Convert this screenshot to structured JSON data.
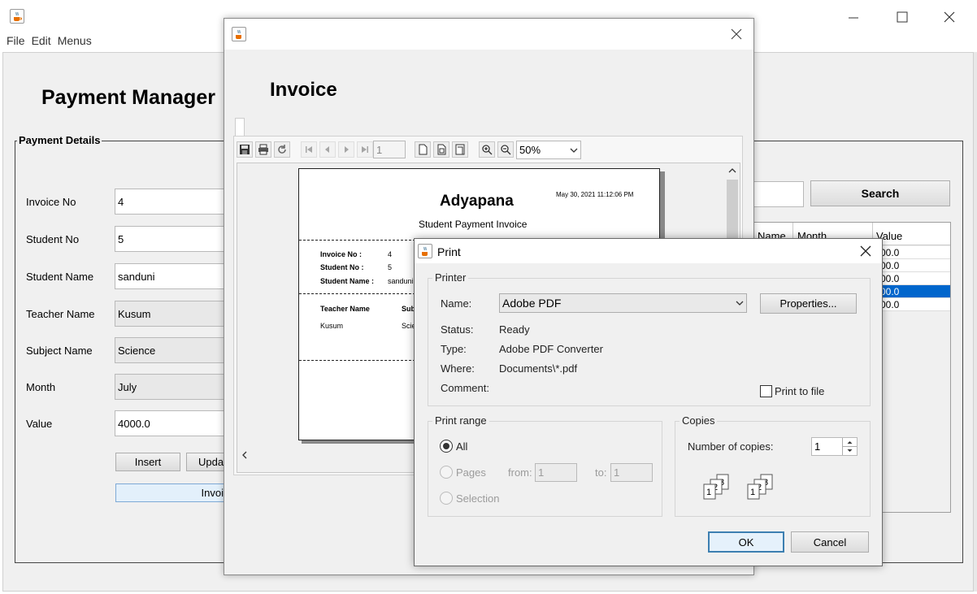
{
  "main_window": {
    "menus": [
      "File",
      "Edit",
      "Menus"
    ],
    "title": "Payment Manager",
    "group_title": "Payment Details",
    "fields": [
      {
        "label": "Invoice No",
        "value": "4",
        "readonly": false
      },
      {
        "label": "Student No",
        "value": "5",
        "readonly": false
      },
      {
        "label": "Student Name",
        "value": "sanduni",
        "readonly": false
      },
      {
        "label": "Teacher Name",
        "value": "Kusum",
        "readonly": true
      },
      {
        "label": "Subject Name",
        "value": "Science",
        "readonly": true
      },
      {
        "label": "Month",
        "value": "July",
        "readonly": true
      },
      {
        "label": "Value",
        "value": "4000.0",
        "readonly": false
      }
    ],
    "insert_label": "Insert",
    "update_label": "Upda",
    "invoice_label": "Invoi",
    "search_label": "Search",
    "table_headers": [
      "Name",
      "Month",
      "Value"
    ],
    "table_values": [
      "00.0",
      "00.0",
      "00.0",
      "00.0",
      "00.0"
    ],
    "selected_row": 3
  },
  "invoice_window": {
    "title": "Invoice",
    "page_number": "1",
    "zoom": "50%",
    "report": {
      "company": "Adyapana",
      "timestamp": "May 30, 2021 11:12:06 PM",
      "subtitle": "Student Payment Invoice",
      "rows": [
        {
          "label": "Invoice No :",
          "value": "4"
        },
        {
          "label": "Student No :",
          "value": "5"
        },
        {
          "label": "Student Name :",
          "value": "sanduni"
        }
      ],
      "teacher_header": "Teacher Name",
      "subject_header": "Sub",
      "teacher_value": "Kusum",
      "subject_value": "Scie"
    }
  },
  "print_dialog": {
    "title": "Print",
    "printer_group": "Printer",
    "name_label": "Name:",
    "printer_name": "Adobe PDF",
    "properties_label": "Properties...",
    "status_label": "Status:",
    "status_value": "Ready",
    "type_label": "Type:",
    "type_value": "Adobe PDF Converter",
    "where_label": "Where:",
    "where_value": "Documents\\*.pdf",
    "comment_label": "Comment:",
    "print_to_file_label": "Print to file",
    "print_range_group": "Print range",
    "all_label": "All",
    "pages_label": "Pages",
    "from_label": "from:",
    "from_value": "1",
    "to_label": "to:",
    "to_value": "1",
    "selection_label": "Selection",
    "copies_group": "Copies",
    "copies_label": "Number of copies:",
    "copies_value": "1",
    "ok_label": "OK",
    "cancel_label": "Cancel"
  },
  "icons": {
    "app": "java-coffee-icon",
    "accent_color": "#0078d7",
    "selection_color": "#0066cc"
  }
}
